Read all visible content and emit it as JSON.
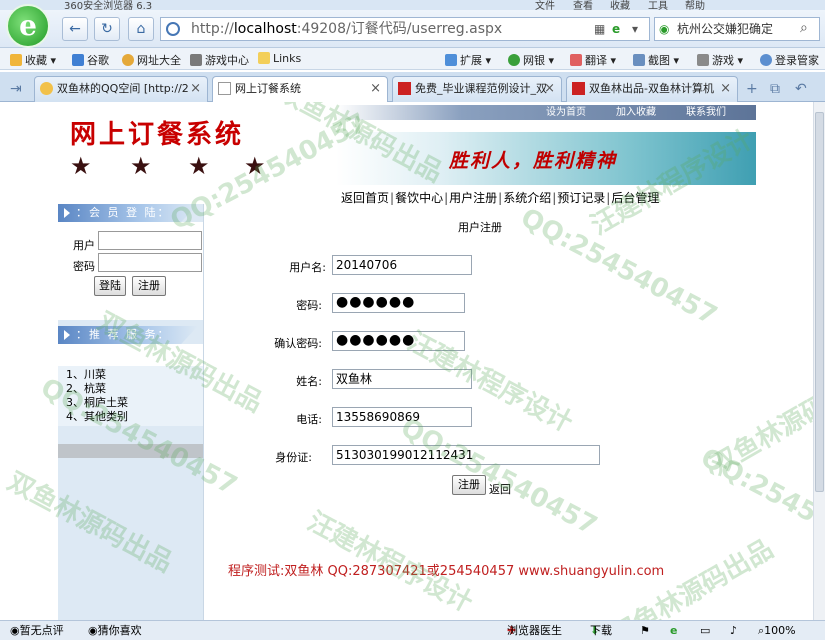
{
  "browser": {
    "title": "360安全浏览器 6.3",
    "menu": [
      "文件",
      "查看",
      "收藏",
      "工具",
      "帮助"
    ],
    "address_host": "localhost",
    "address_rest": ":49208/订餐代码/userreg.aspx",
    "address_prefix": "http://",
    "search_text": "杭州公交嫌犯确定"
  },
  "bookmarks": [
    "收藏",
    "谷歌",
    "网址大全",
    "游戏中心",
    "Links",
    "扩展",
    "网银",
    "翻译",
    "截图",
    "游戏",
    "登录管家"
  ],
  "tabs": [
    {
      "label": "双鱼林的QQ空间 [http://2",
      "active": false
    },
    {
      "label": "网上订餐系统",
      "active": true
    },
    {
      "label": "免费_毕业课程范例设计_双",
      "active": false
    },
    {
      "label": "双鱼林出品-双鱼林计算机",
      "active": false
    }
  ],
  "site": {
    "toplinks": [
      "设为首页",
      "加入收藏",
      "联系我们"
    ],
    "title": "网上订餐系统",
    "slogan": "胜利人，胜利精神",
    "menu": [
      "返回首页",
      "餐饮中心",
      "用户注册",
      "系统介绍",
      "预订记录",
      "后台管理"
    ]
  },
  "sidebar": {
    "login_heading": "：会 员 登 陆：",
    "user_label": "用户",
    "password_label": "密码",
    "login_button": "登陆",
    "register_button": "注册",
    "recommend_heading": "：推 荐 服 务：",
    "recommend_items": [
      "1、川菜",
      "2、杭菜",
      "3、桐庐土菜",
      "4、其他类别"
    ]
  },
  "form": {
    "title": "用户注册",
    "fields": [
      {
        "label": "用户名:",
        "value": "20140706"
      },
      {
        "label": "密码:",
        "value": "●●●●●●"
      },
      {
        "label": "确认密码:",
        "value": "●●●●●●"
      },
      {
        "label": "姓名:",
        "value": "双鱼林"
      },
      {
        "label": "电话:",
        "value": "13558690869"
      },
      {
        "label": "身份证:",
        "value": "513030199012112431"
      }
    ],
    "submit": "注册",
    "back": "返回"
  },
  "footer": "程序测试:双鱼林 QQ:287307421或254540457 www.shuangyulin.com",
  "watermarks": [
    "QQ:254540457",
    "双鱼林源码出品",
    "汪建林程序设计"
  ],
  "statusbar": {
    "left1": "暂无点评",
    "left2": "猜你喜欢",
    "doctor": "浏览器医生",
    "download": "下载",
    "zoom": "100%"
  },
  "colors": {
    "title_red": "#c80000",
    "footer_red": "#c02020",
    "sidebar_bg": "#dde9f4"
  }
}
